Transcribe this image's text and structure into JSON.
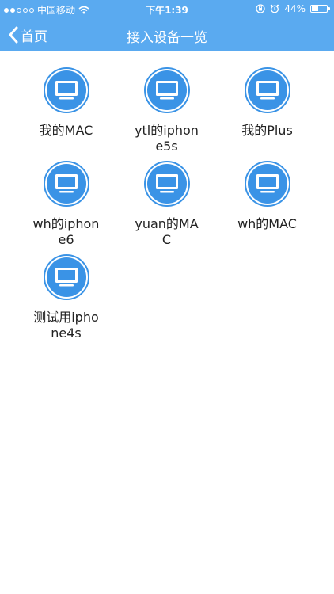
{
  "status_bar": {
    "carrier": "中国移动",
    "time": "下午1:39",
    "battery_percent_text": "44%",
    "battery_level": 0.44,
    "icons": [
      "signal-icon",
      "wifi-icon",
      "rotation-lock-icon",
      "alarm-icon",
      "battery-icon"
    ]
  },
  "nav": {
    "back_label": "首页",
    "title": "接入设备一览"
  },
  "colors": {
    "nav_bg": "#5aaaf0",
    "icon_blue": "#3a93e6"
  },
  "devices": [
    {
      "label": "我的MAC"
    },
    {
      "label": "ytl的iphone5s"
    },
    {
      "label": "我的Plus"
    },
    {
      "label": "wh的iphone6"
    },
    {
      "label": "yuan的MAC"
    },
    {
      "label": "wh的MAC"
    },
    {
      "label": "测试用iphone4s"
    }
  ]
}
